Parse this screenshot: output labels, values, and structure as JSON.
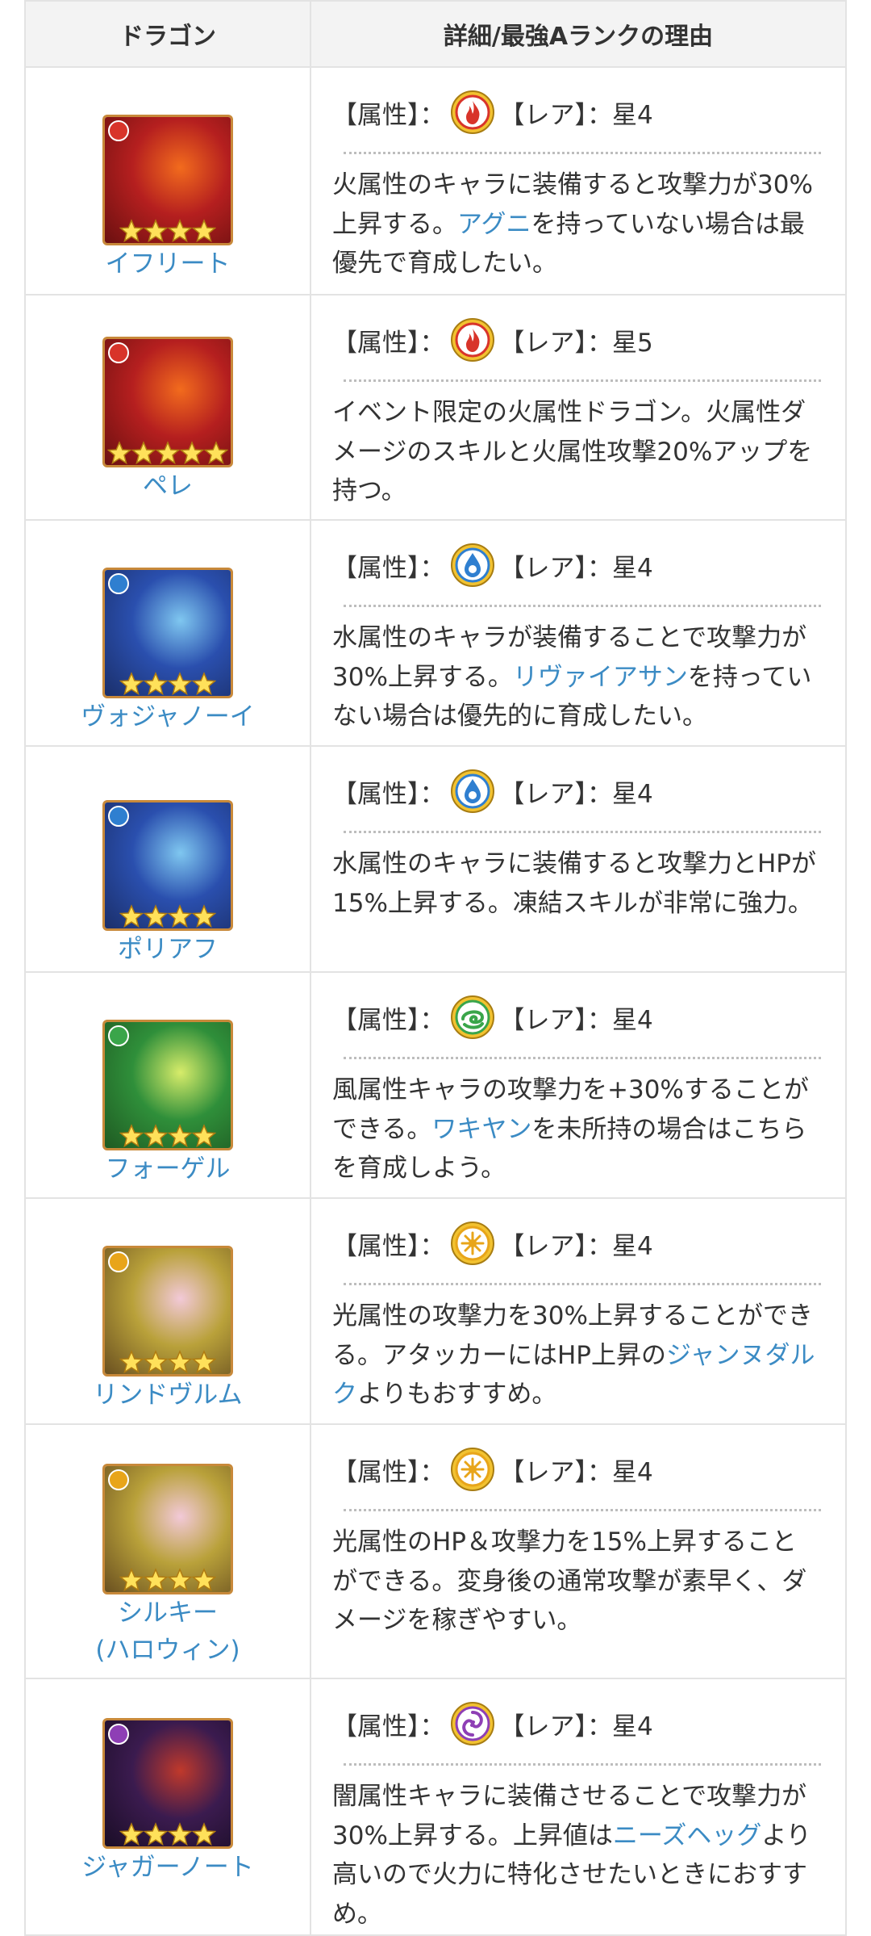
{
  "headers": {
    "dragon": "ドラゴン",
    "detail": "詳細/最強Aランクの理由"
  },
  "labels": {
    "attr": "【属性】：",
    "rare": "【レア】："
  },
  "rows": [
    {
      "name": "イフリート",
      "element": "fire",
      "rare": "星4",
      "stars": 4,
      "desc": [
        "火属性のキャラに装備すると攻撃力が30%上昇する。",
        "アグニ",
        "を持っていない場合は最優先で育成したい。"
      ]
    },
    {
      "name": "ペレ",
      "element": "fire",
      "rare": "星5",
      "stars": 5,
      "desc": [
        "イベント限定の火属性ドラゴン。火属性ダメージのスキルと火属性攻撃20%アップを持つ。",
        "",
        ""
      ]
    },
    {
      "name": "ヴォジャノーイ",
      "element": "water",
      "rare": "星4",
      "stars": 4,
      "desc": [
        "水属性のキャラが装備することで攻撃力が30%上昇する。",
        "リヴァイアサン",
        "を持っていない場合は優先的に育成したい。"
      ]
    },
    {
      "name": "ポリアフ",
      "element": "water",
      "rare": "星4",
      "stars": 4,
      "desc": [
        "水属性のキャラに装備すると攻撃力とHPが15%上昇する。凍結スキルが非常に強力。",
        "",
        ""
      ]
    },
    {
      "name": "フォーゲル",
      "element": "wind",
      "rare": "星4",
      "stars": 4,
      "desc": [
        "風属性キャラの攻撃力を+30%することができる。",
        "ワキヤン",
        "を未所持の場合はこちらを育成しよう。"
      ]
    },
    {
      "name": "リンドヴルム",
      "element": "light",
      "rare": "星4",
      "stars": 4,
      "desc": [
        "光属性の攻撃力を30%上昇することができる。アタッカーにはHP上昇の",
        "ジャンヌダルク",
        "よりもおすすめ。"
      ]
    },
    {
      "name": "シルキー",
      "name2": "(ハロウィン)",
      "element": "light",
      "rare": "星4",
      "stars": 4,
      "desc": [
        "光属性のHP＆攻撃力を15%上昇することができる。変身後の通常攻撃が素早く、ダメージを稼ぎやすい。",
        "",
        ""
      ]
    },
    {
      "name": "ジャガーノート",
      "element": "dark",
      "rare": "星4",
      "stars": 4,
      "desc": [
        "闇属性キャラに装備させることで攻撃力が30%上昇する。上昇値は",
        "ニーズヘッグ",
        "より高いので火力に特化させたいときにおすすめ。"
      ]
    }
  ],
  "colors": {
    "fire": "#d8342a",
    "water": "#2f7fd0",
    "wind": "#3aa54a",
    "light": "#e8a51a",
    "dark": "#8e3fb5",
    "link": "#3b8bc4",
    "border": "#e3e3e3",
    "header_bg": "#f3f3f3",
    "frame": "#c8893a"
  }
}
